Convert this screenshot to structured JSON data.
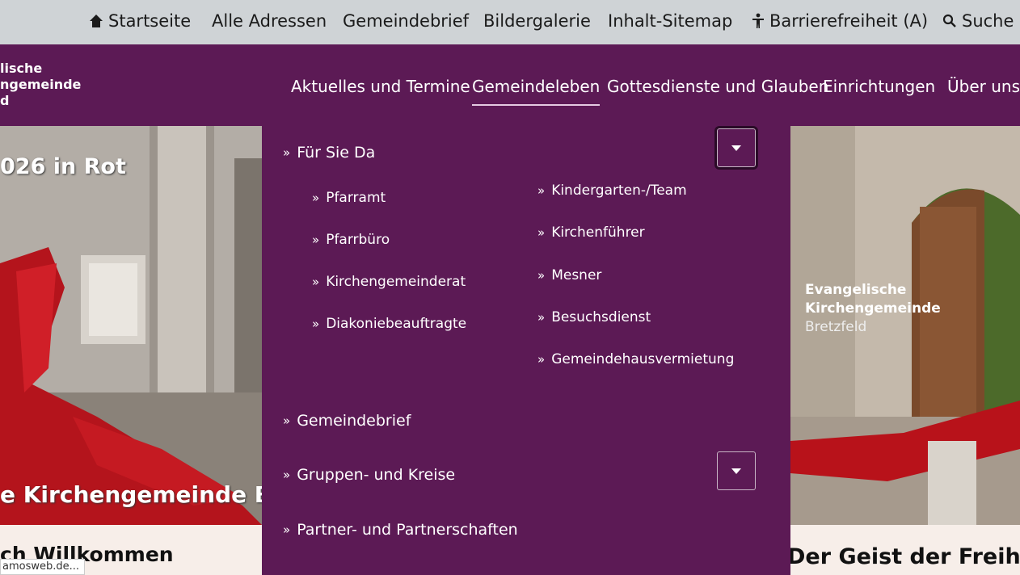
{
  "topbar": {
    "items": [
      {
        "label": "Startseite",
        "icon": "home-icon"
      },
      {
        "label": "Alle Adressen"
      },
      {
        "label": "Gemeindebrief"
      },
      {
        "label": "Bildergalerie"
      },
      {
        "label": "Inhalt-Sitemap"
      },
      {
        "label": "Barrierefreiheit (A)",
        "icon": "accessibility-icon"
      },
      {
        "label": "Suche",
        "icon": "search-icon"
      }
    ]
  },
  "logo": {
    "line1": "lische",
    "line2": "ngemeinde",
    "line3": "d"
  },
  "mainnav": [
    {
      "label": "Aktuelles und Termine"
    },
    {
      "label": "Gemeindeleben",
      "active": true
    },
    {
      "label": "Gottesdienste und Glauben"
    },
    {
      "label": "Einrichtungen"
    },
    {
      "label": "Über uns"
    }
  ],
  "dropdown": {
    "sections": [
      {
        "label": "Für Sie Da",
        "expanded": true,
        "left": [
          "Pfarramt",
          "Pfarrbüro",
          "Kirchengemeinderat",
          "Diakoniebeauftragte"
        ],
        "right": [
          "Kindergarten-/Team",
          "Kirchenführer",
          "Mesner",
          "Besuchsdienst",
          "Gemeindehausvermietung"
        ]
      },
      {
        "label": "Gemeindebrief"
      },
      {
        "label": "Gruppen- und Kreise",
        "expandable": true
      },
      {
        "label": "Partner- und Partnerschaften"
      }
    ]
  },
  "hero": {
    "left_text_top": "026 in Rot",
    "left_text_bottom": "e Kirchengemeinde B",
    "right_caption": {
      "line1": "Evangelische",
      "line2": "Kirchengemeinde",
      "line3": "Bretzfeld"
    }
  },
  "content": {
    "welcome": "ch Willkommen",
    "freiheit": "Der Geist der Freiheit"
  },
  "status_url": "amosweb.de...",
  "colors": {
    "purple": "#5c1a55",
    "topbar": "#cfd3d6",
    "page": "#f7eee9"
  }
}
